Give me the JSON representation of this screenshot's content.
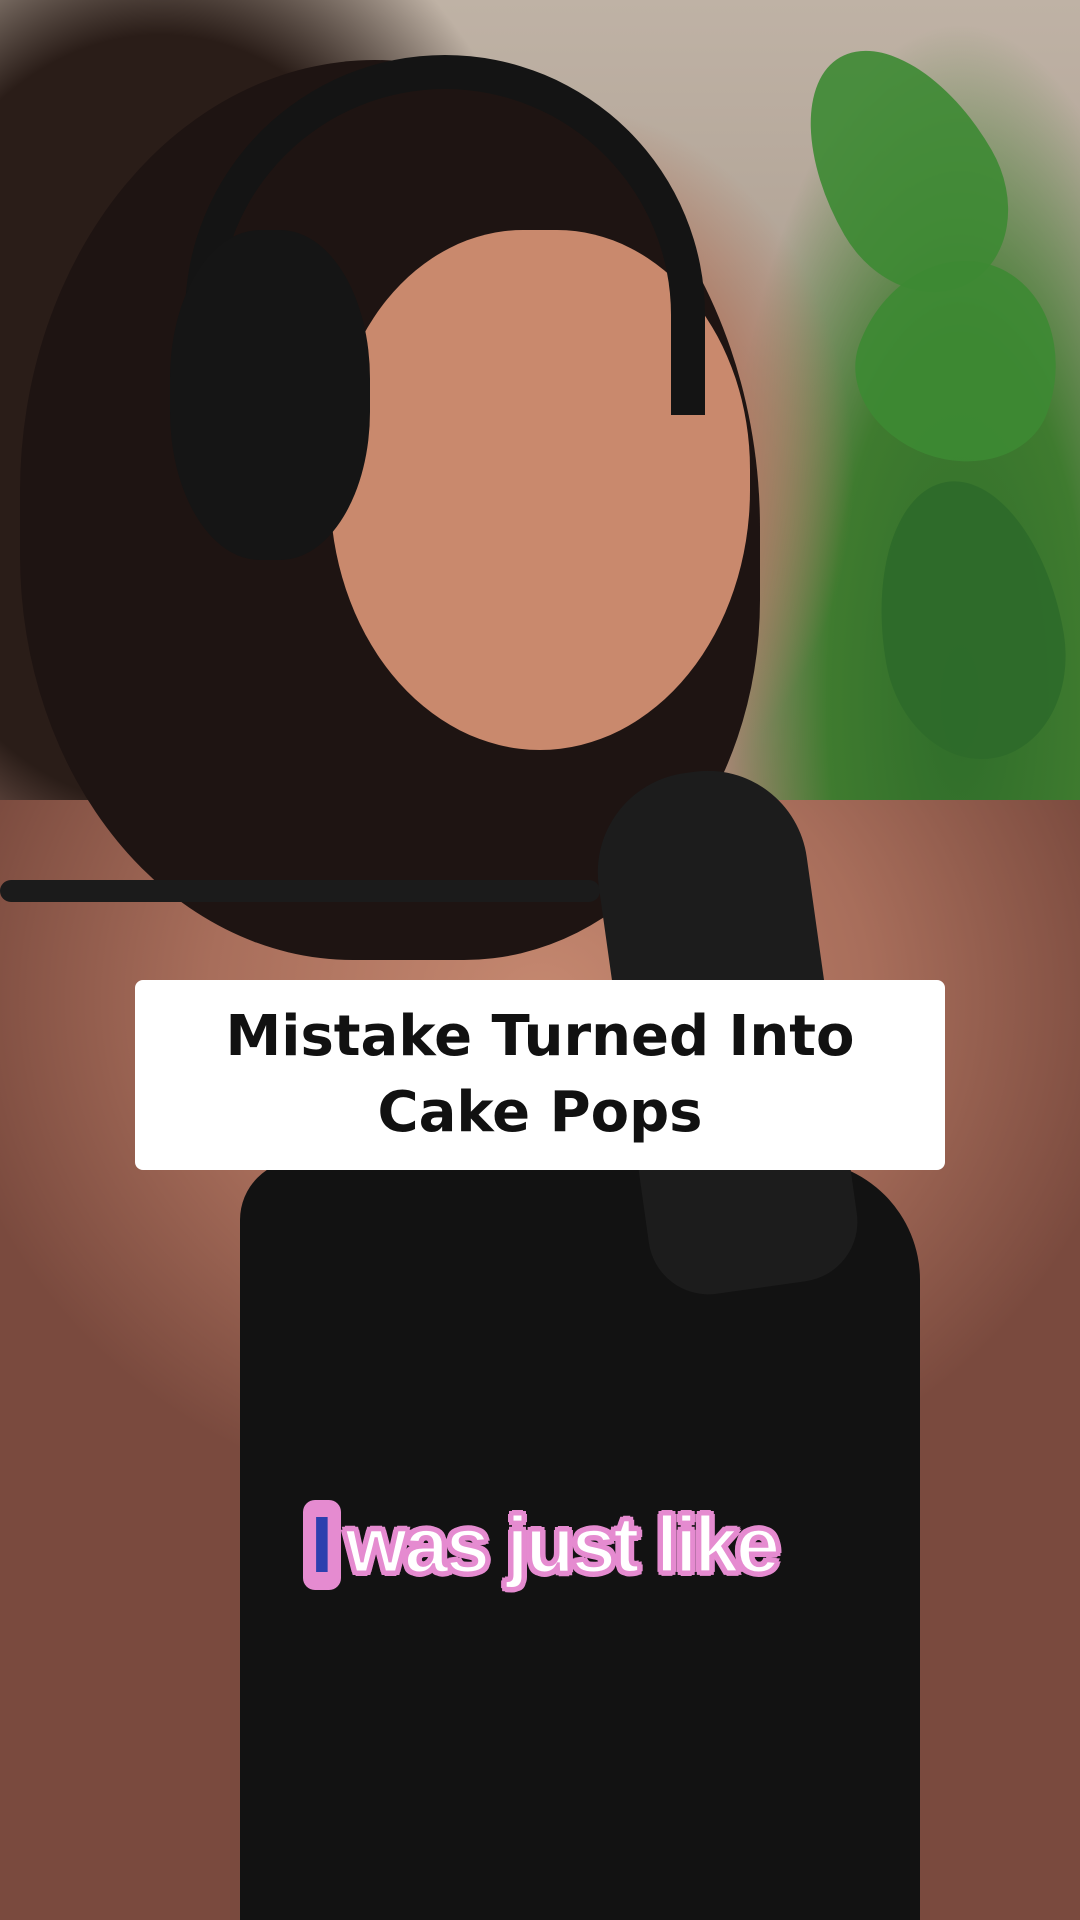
{
  "overlay": {
    "title": "Mistake Turned Into Cake Pops"
  },
  "caption": {
    "words": [
      "I",
      "was just like"
    ]
  },
  "colors": {
    "title_card_bg": "#ffffff",
    "title_text": "#111111",
    "caption_text": "#ffffff",
    "caption_outline": "#e58bd0",
    "caption_highlight_bg": "#e58bd0",
    "caption_highlight_text": "#2c3fae"
  }
}
